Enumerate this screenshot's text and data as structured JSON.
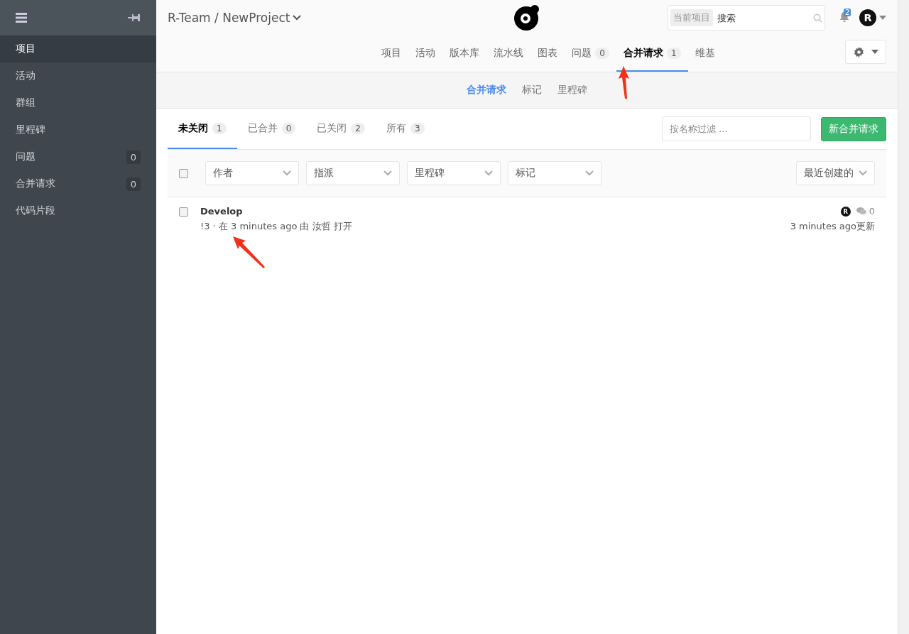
{
  "sidebar": {
    "items": [
      {
        "label": "项目",
        "selected": true
      },
      {
        "label": "活动",
        "selected": false
      },
      {
        "label": "群组",
        "selected": false
      },
      {
        "label": "里程碑",
        "selected": false
      },
      {
        "label": "问题",
        "selected": false,
        "count": "0"
      },
      {
        "label": "合并请求",
        "selected": false,
        "count": "0"
      },
      {
        "label": "代码片段",
        "selected": false
      }
    ]
  },
  "header": {
    "breadcrumb": "R-Team / NewProject",
    "search": {
      "scope": "当前项目",
      "placeholder": "搜索"
    },
    "notifications": "2",
    "avatar": "R"
  },
  "nav_tabs": [
    {
      "label": "项目",
      "selected": false
    },
    {
      "label": "活动",
      "selected": false
    },
    {
      "label": "版本库",
      "selected": false
    },
    {
      "label": "流水线",
      "selected": false
    },
    {
      "label": "图表",
      "selected": false
    },
    {
      "label": "问题",
      "selected": false,
      "count": "0"
    },
    {
      "label": "合并请求",
      "selected": true,
      "count": "1"
    },
    {
      "label": "维基",
      "selected": false
    }
  ],
  "sub_nav": [
    {
      "label": "合并请求",
      "selected": true
    },
    {
      "label": "标记",
      "selected": false
    },
    {
      "label": "里程碑",
      "selected": false
    }
  ],
  "state_tabs": [
    {
      "label": "未关闭",
      "count": "1",
      "selected": true
    },
    {
      "label": "已合并",
      "count": "0",
      "selected": false
    },
    {
      "label": "已关闭",
      "count": "2",
      "selected": false
    },
    {
      "label": "所有",
      "count": "3",
      "selected": false
    }
  ],
  "name_filter": {
    "placeholder": "按名称过滤 ..."
  },
  "new_button": "新合并请求",
  "select_all": {
    "checked": false
  },
  "filters": [
    "作者",
    "指派",
    "里程碑",
    "标记"
  ],
  "sort": "最近创建的",
  "merge_requests": [
    {
      "title": "Develop",
      "checked": false,
      "meta": "!3 · 在 3 minutes ago 由 汝哲 打开",
      "author_avatar": "R",
      "comments": "0",
      "updated": "3 minutes ago更新"
    }
  ]
}
